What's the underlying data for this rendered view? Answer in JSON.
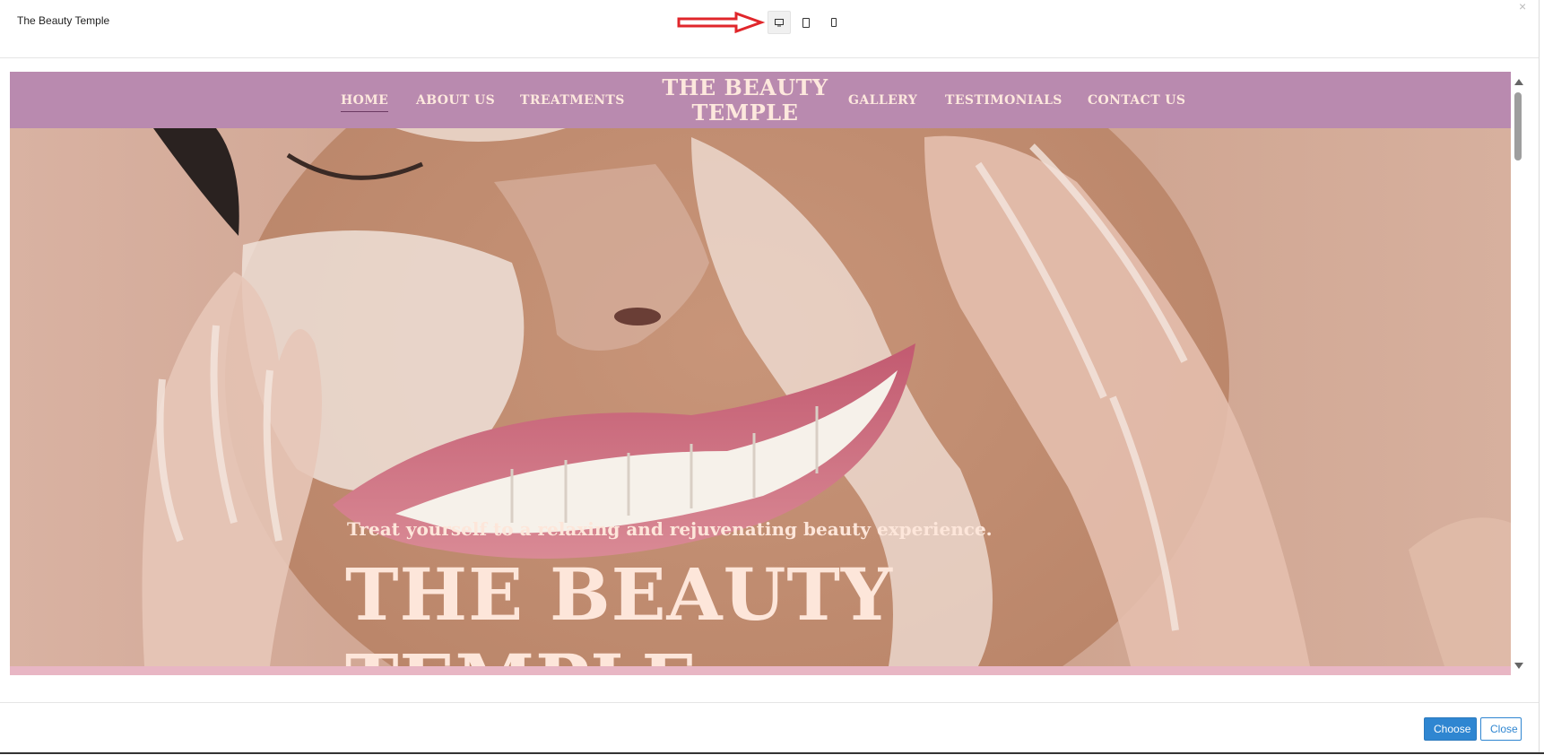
{
  "modal": {
    "title": "The Beauty Temple",
    "close_glyph": "×",
    "device_buttons": [
      {
        "name": "desktop",
        "icon": "desktop-icon",
        "active": true
      },
      {
        "name": "tablet",
        "icon": "tablet-icon",
        "active": false
      },
      {
        "name": "mobile",
        "icon": "mobile-icon",
        "active": false
      }
    ],
    "annotation": {
      "icon": "red-arrow-icon",
      "color": "#e0262b"
    }
  },
  "site": {
    "nav": {
      "items_left": [
        "HOME",
        "ABOUT US",
        "TREATMENTS"
      ],
      "brand": "THE BEAUTY TEMPLE",
      "items_right": [
        "GALLERY",
        "TESTIMONIALS",
        "CONTACT US"
      ],
      "active": "HOME"
    },
    "hero": {
      "tagline": "Treat yourself to a relaxing and rejuvenating beauty experience.",
      "title": "THE BEAUTY TEMPLE"
    }
  },
  "footer": {
    "choose_label": "Choose",
    "close_label": "Close"
  },
  "colors": {
    "nav_bg": "#b98aaf",
    "nav_text": "#fde8dd",
    "hero_text": "#fde6da",
    "primary_button": "#2f86d1",
    "hero_strip": "#e8b6c4"
  }
}
